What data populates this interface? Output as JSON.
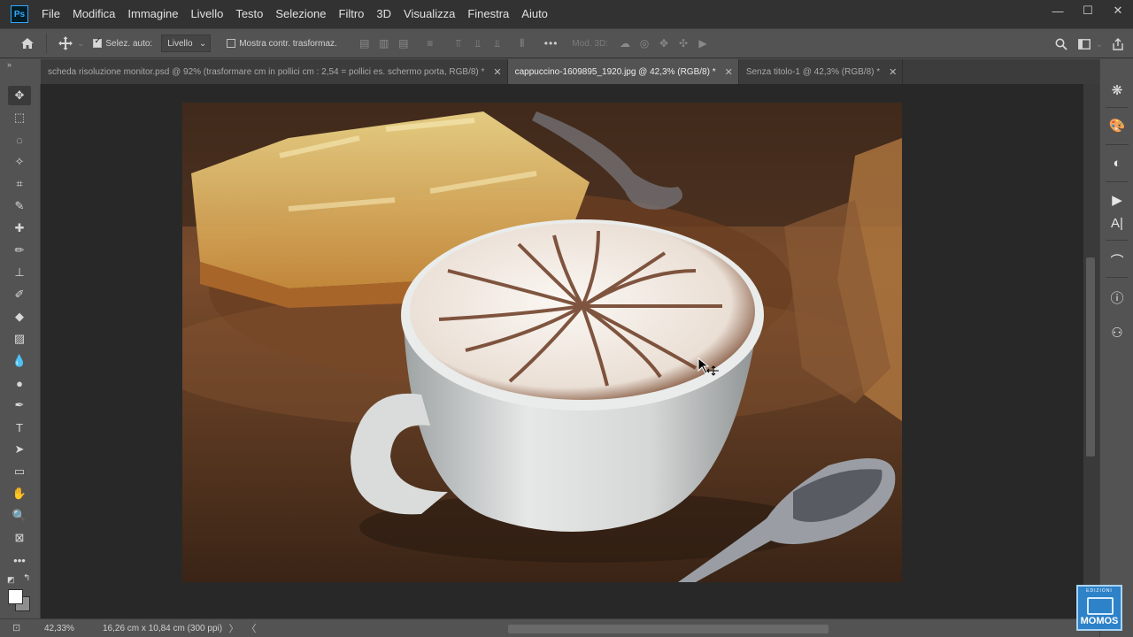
{
  "app": {
    "logo": "Ps"
  },
  "menu": [
    "File",
    "Modifica",
    "Immagine",
    "Livello",
    "Testo",
    "Selezione",
    "Filtro",
    "3D",
    "Visualizza",
    "Finestra",
    "Aiuto"
  ],
  "window_controls": {
    "minimize": "—",
    "maximize": "☐",
    "close": "✕"
  },
  "options": {
    "home_icon": "home-icon",
    "move_icon": "move-icon",
    "autoselect_label": "Selez. auto:",
    "autoselect_checked": true,
    "autoselect_value": "Livello",
    "show_transform_label": "Mostra contr. trasformaz.",
    "show_transform_checked": false,
    "more": "•••",
    "mode3d_label": "Mod. 3D:"
  },
  "tabs": [
    {
      "label": "scheda risoluzione monitor.psd @ 92% (trasformare cm in pollici cm : 2,54 = pollici es. schermo porta, RGB/8) *",
      "active": false
    },
    {
      "label": "cappuccino-1609895_1920.jpg @ 42,3% (RGB/8) *",
      "active": true
    },
    {
      "label": "Senza titolo-1 @ 42,3% (RGB/8) *",
      "active": false
    }
  ],
  "tab_close": "✕",
  "collapse": "»",
  "status": {
    "zoom": "42,33%",
    "doc_info": "16,26 cm x 10,84 cm (300 ppi)",
    "arrow_right": "〉",
    "arrow_left": "〈"
  },
  "watermark": {
    "top": "EDIZIONI",
    "word": "MOMOS"
  },
  "colors": {
    "accent": "#31a8ff",
    "panel": "#535353",
    "menubar": "#323232",
    "canvas_bg": "#282828"
  }
}
